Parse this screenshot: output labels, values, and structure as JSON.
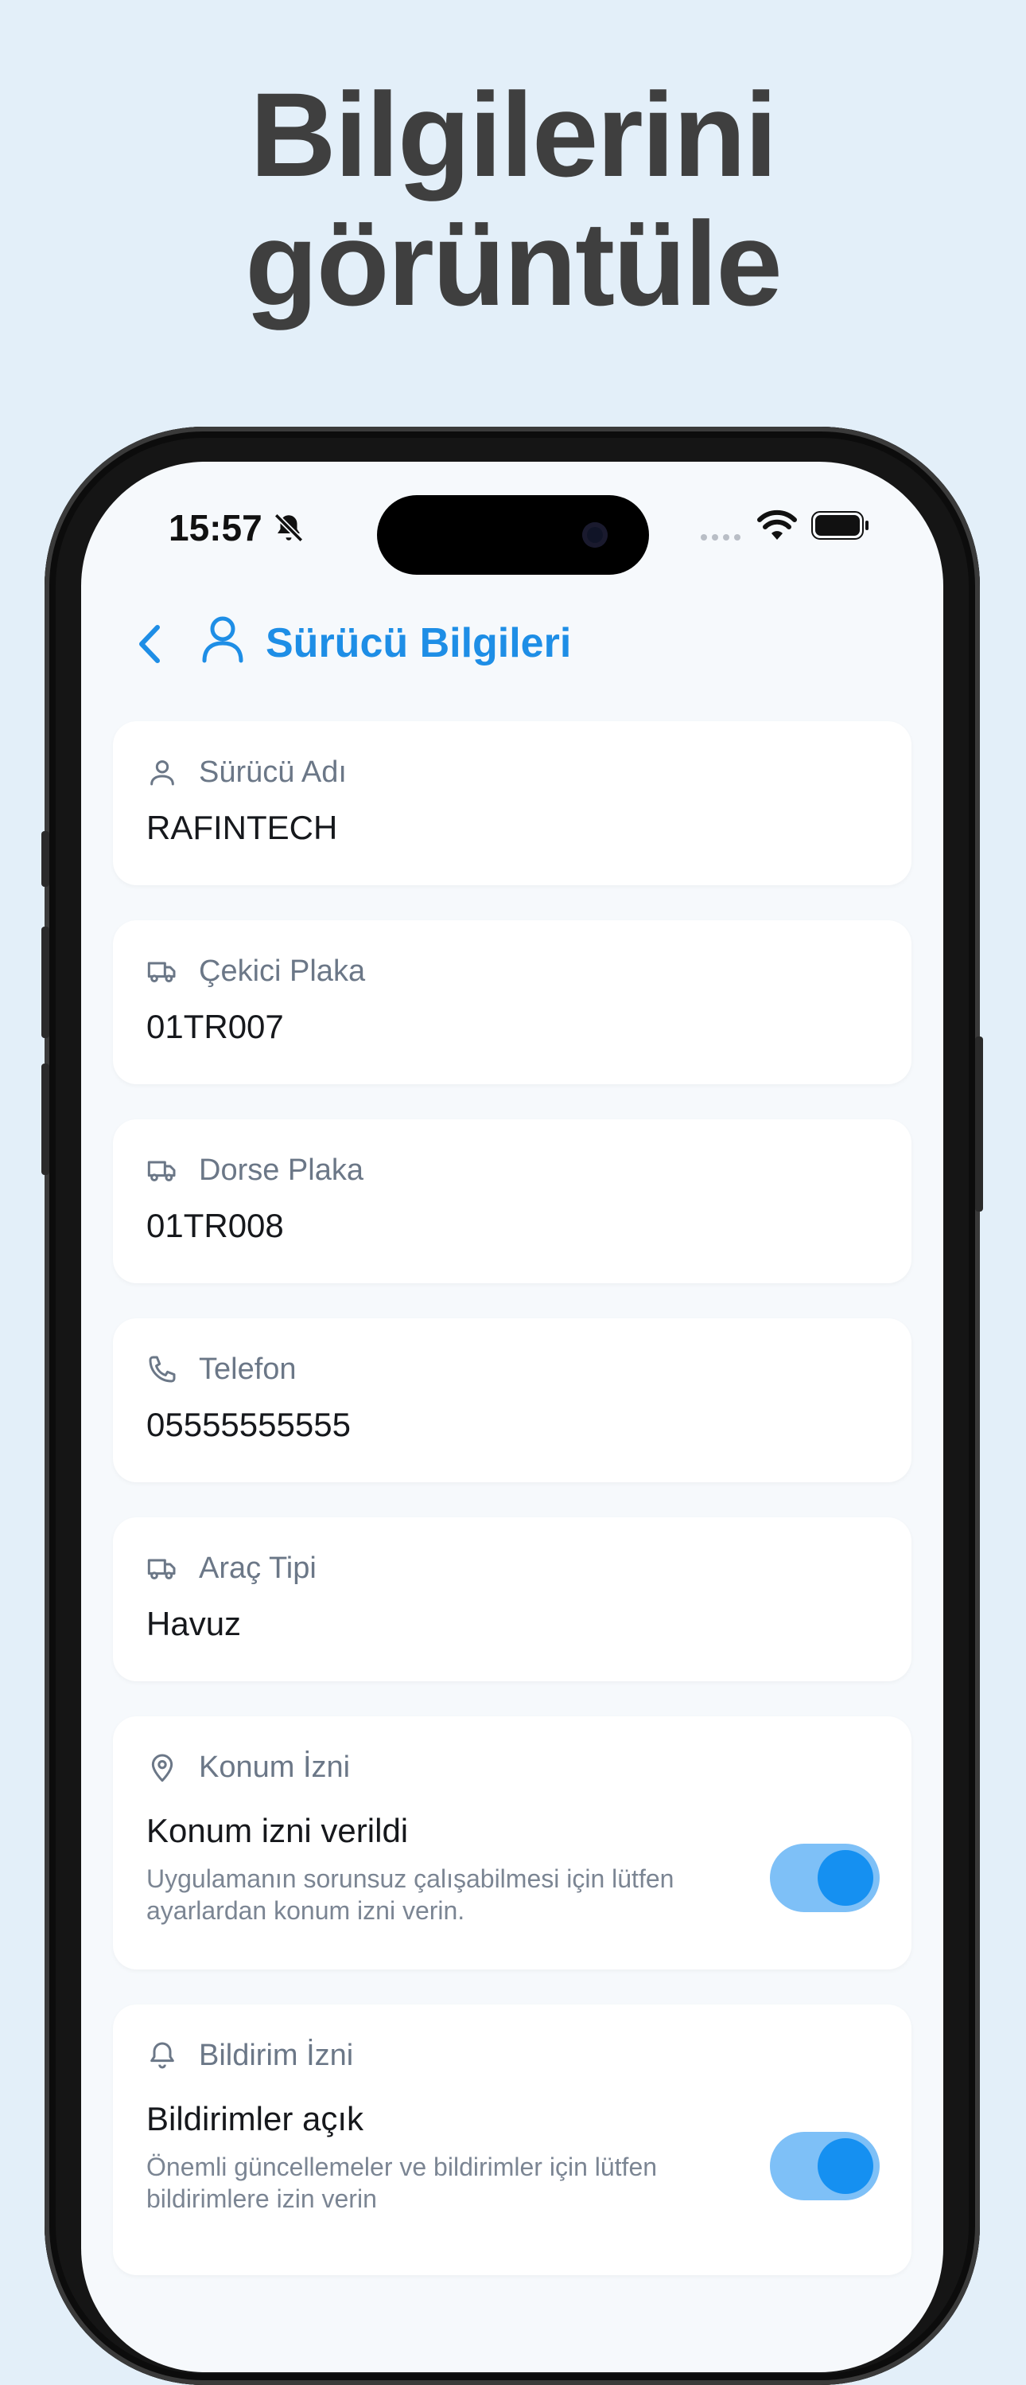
{
  "headline": {
    "line1": "Bilgilerini",
    "line2": "görüntüle"
  },
  "status_bar": {
    "time": "15:57",
    "bell_icon": "bell-slash-icon",
    "wifi_icon": "wifi-icon",
    "battery_icon": "battery-icon"
  },
  "header": {
    "title": "Sürücü Bilgileri",
    "back_icon": "chevron-left-icon",
    "user_icon": "user-icon"
  },
  "fields": [
    {
      "label": "Sürücü Adı",
      "value": "RAFINTECH",
      "icon": "user-icon"
    },
    {
      "label": "Çekici Plaka",
      "value": "01TR007",
      "icon": "truck-icon"
    },
    {
      "label": "Dorse Plaka",
      "value": "01TR008",
      "icon": "truck-icon"
    },
    {
      "label": "Telefon",
      "value": "05555555555",
      "icon": "phone-icon"
    },
    {
      "label": "Araç Tipi",
      "value": "Havuz",
      "icon": "truck-icon"
    }
  ],
  "permissions": [
    {
      "label": "Konum İzni",
      "title": "Konum izni verildi",
      "description": "Uygulamanın sorunsuz çalışabilmesi için lütfen ayarlardan konum izni verin.",
      "enabled": true,
      "icon": "map-pin-icon"
    },
    {
      "label": "Bildirim İzni",
      "title": "Bildirimler açık",
      "description": "Önemli güncellemeler ve bildirimler için lütfen bildirimlere izin verin",
      "enabled": true,
      "icon": "bell-icon"
    }
  ],
  "colors": {
    "accent": "#1e8ee6",
    "background": "#e3eff9",
    "toggle_on": "#1590f1",
    "toggle_track": "#7ec0f7"
  }
}
